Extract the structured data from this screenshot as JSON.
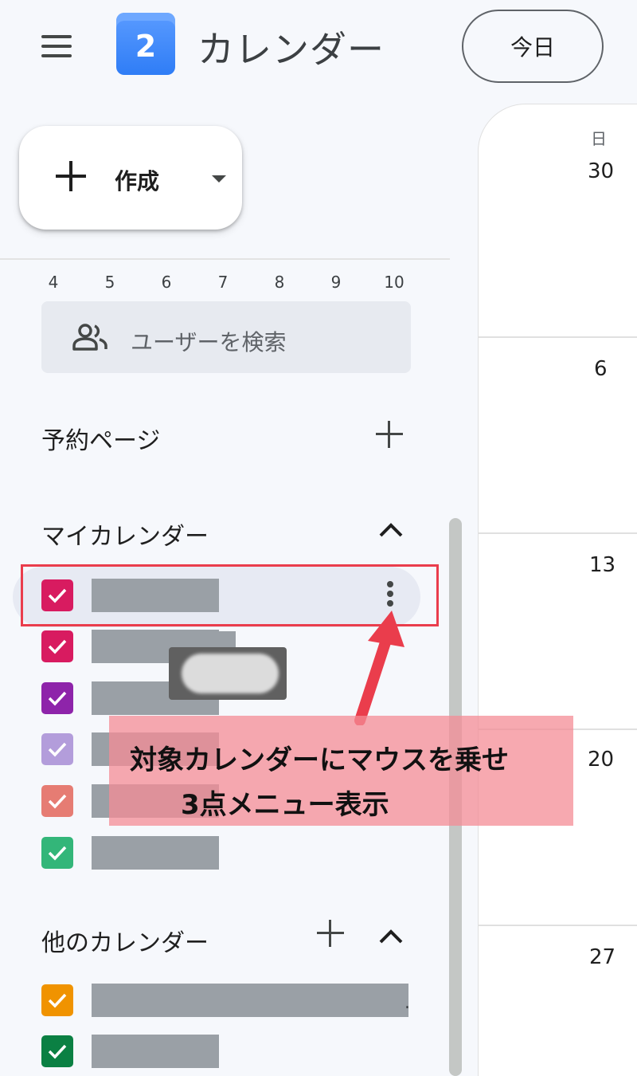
{
  "header": {
    "app_title": "カレンダー",
    "logo_text": "2",
    "today_button": "今日"
  },
  "sidebar": {
    "create_button": "作成",
    "mini_calendar_days": [
      "4",
      "5",
      "6",
      "7",
      "8",
      "9",
      "10"
    ],
    "search_placeholder": "ユーザーを検索",
    "booking_pages_title": "予約ページ",
    "my_calendars_title": "マイカレンダー",
    "my_calendars": [
      {
        "color": "#d81b60",
        "checked": true,
        "hovered": true
      },
      {
        "color": "#d81b60",
        "checked": true
      },
      {
        "color": "#8e24aa",
        "checked": true
      },
      {
        "color": "#b39ddb",
        "checked": true
      },
      {
        "color": "#e67c73",
        "checked": true
      },
      {
        "color": "#33b679",
        "checked": true
      }
    ],
    "other_calendars_title": "他のカレンダー",
    "other_calendars": [
      {
        "color": "#f09300",
        "checked": true,
        "truncated_suffix": "."
      },
      {
        "color": "#0b8043",
        "checked": true
      }
    ]
  },
  "annotation": {
    "line1": "対象カレンダーにマウスを乗せ",
    "line2": "3点メニュー表示",
    "color": "#ea3d4c"
  },
  "main": {
    "day_of_week": "日",
    "dates": [
      "30",
      "6",
      "13",
      "20",
      "27"
    ]
  }
}
